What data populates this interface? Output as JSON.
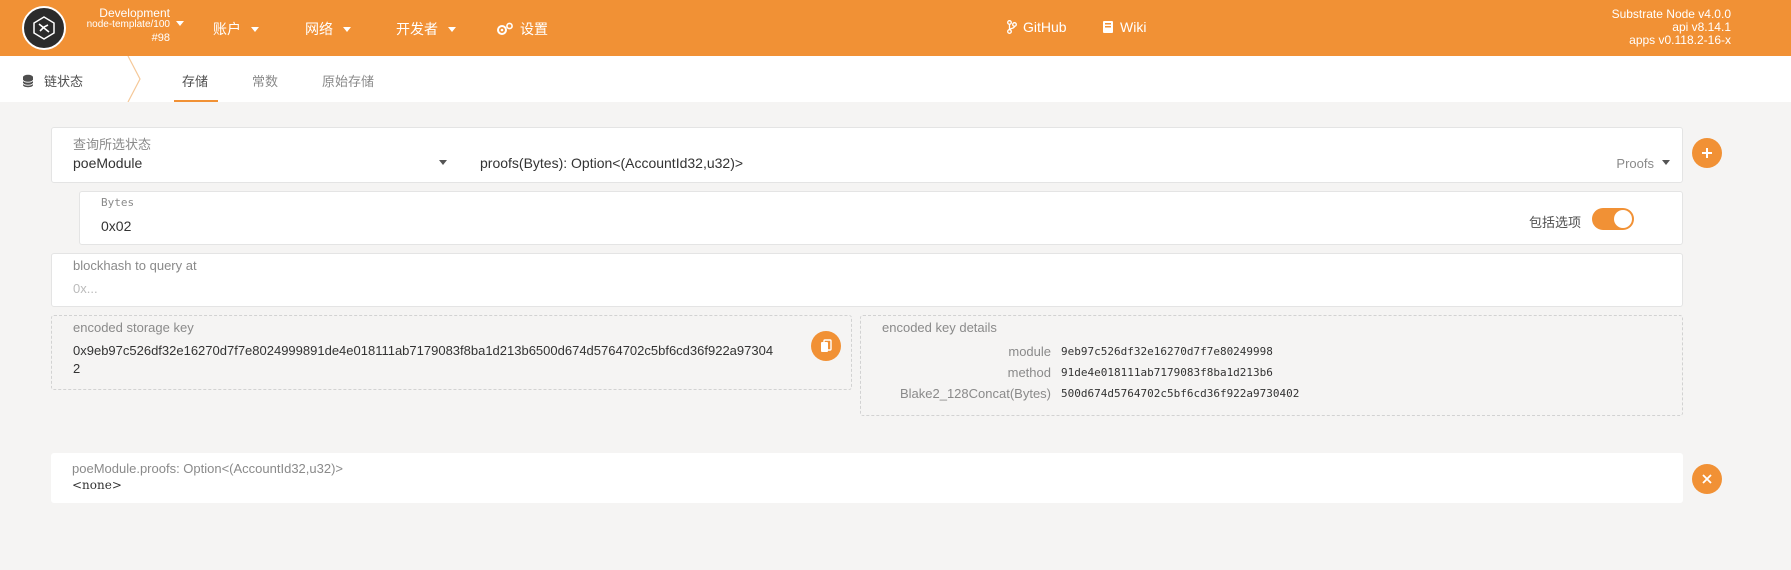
{
  "header": {
    "chain_name": "Development",
    "chain_spec": "node-template/100",
    "block_number": "#98",
    "menu": [
      {
        "label": "账户"
      },
      {
        "label": "网络"
      },
      {
        "label": "开发者"
      },
      {
        "label": "设置"
      }
    ],
    "github_label": "GitHub",
    "wiki_label": "Wiki",
    "node_version": "Substrate Node v4.0.0",
    "api_version": "api v8.14.1",
    "apps_version": "apps v0.118.2-16-x"
  },
  "tabs": {
    "section_label": "链状态",
    "items": [
      {
        "label": "存储",
        "active": true
      },
      {
        "label": "常数",
        "active": false
      },
      {
        "label": "原始存储",
        "active": false
      }
    ]
  },
  "query": {
    "label": "查询所选状态",
    "module": "poeModule",
    "method": "proofs(Bytes): Option<(AccountId32,u32)>",
    "method_hint": "Proofs"
  },
  "bytes": {
    "label": "Bytes",
    "value": "0x02",
    "toggle_label": "包括选项",
    "toggle_on": true
  },
  "blockhash": {
    "label": "blockhash to query at",
    "placeholder": "0x..."
  },
  "encoded_key": {
    "label": "encoded storage key",
    "value_line1": "0x9eb97c526df32e16270d7f7e8024999891de4e018111ab7179083f8ba1d213b6500d674d5764702c5bf6cd36f922a97304",
    "value_line2": "2"
  },
  "key_details": {
    "label": "encoded key details",
    "rows": [
      {
        "key": "module",
        "value": "9eb97c526df32e16270d7f7e80249998"
      },
      {
        "key": "method",
        "value": "91de4e018111ab7179083f8ba1d213b6"
      },
      {
        "key": "Blake2_128Concat(Bytes)",
        "value": "500d674d5764702c5bf6cd36f922a9730402"
      }
    ]
  },
  "result": {
    "label": "poeModule.proofs: Option<(AccountId32,u32)>",
    "value": "<none>"
  },
  "colors": {
    "accent": "#f19135",
    "background": "#f5f4f3"
  }
}
